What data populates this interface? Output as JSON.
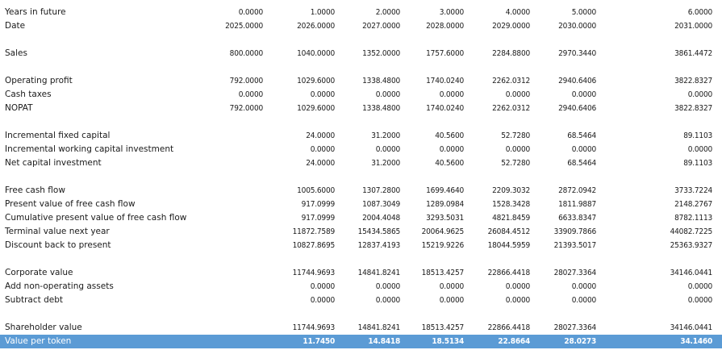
{
  "sheet": {
    "highlight_color": "#5b9bd5",
    "columns": 7,
    "rows": [
      {
        "label": "Years in future",
        "values": [
          "0.0000",
          "1.0000",
          "2.0000",
          "3.0000",
          "4.0000",
          "5.0000",
          "6.0000"
        ]
      },
      {
        "label": "Date",
        "values": [
          "2025.0000",
          "2026.0000",
          "2027.0000",
          "2028.0000",
          "2029.0000",
          "2030.0000",
          "2031.0000"
        ]
      },
      {
        "label": "",
        "values": []
      },
      {
        "label": "Sales",
        "values": [
          "800.0000",
          "1040.0000",
          "1352.0000",
          "1757.6000",
          "2284.8800",
          "2970.3440",
          "3861.4472"
        ]
      },
      {
        "label": "",
        "values": []
      },
      {
        "label": "Operating profit",
        "values": [
          "792.0000",
          "1029.6000",
          "1338.4800",
          "1740.0240",
          "2262.0312",
          "2940.6406",
          "3822.8327"
        ]
      },
      {
        "label": "Cash taxes",
        "values": [
          "0.0000",
          "0.0000",
          "0.0000",
          "0.0000",
          "0.0000",
          "0.0000",
          "0.0000"
        ]
      },
      {
        "label": "NOPAT",
        "values": [
          "792.0000",
          "1029.6000",
          "1338.4800",
          "1740.0240",
          "2262.0312",
          "2940.6406",
          "3822.8327"
        ]
      },
      {
        "label": "",
        "values": []
      },
      {
        "label": "Incremental fixed capital",
        "values": [
          "",
          "24.0000",
          "31.2000",
          "40.5600",
          "52.7280",
          "68.5464",
          "89.1103"
        ]
      },
      {
        "label": "Incremental working capital investment",
        "values": [
          "",
          "0.0000",
          "0.0000",
          "0.0000",
          "0.0000",
          "0.0000",
          "0.0000"
        ]
      },
      {
        "label": "Net capital investment",
        "values": [
          "",
          "24.0000",
          "31.2000",
          "40.5600",
          "52.7280",
          "68.5464",
          "89.1103"
        ]
      },
      {
        "label": "",
        "values": []
      },
      {
        "label": "Free cash flow",
        "values": [
          "",
          "1005.6000",
          "1307.2800",
          "1699.4640",
          "2209.3032",
          "2872.0942",
          "3733.7224"
        ]
      },
      {
        "label": "Present value of free cash flow",
        "values": [
          "",
          "917.0999",
          "1087.3049",
          "1289.0984",
          "1528.3428",
          "1811.9887",
          "2148.2767"
        ]
      },
      {
        "label": "Cumulative present value of free cash flow",
        "values": [
          "",
          "917.0999",
          "2004.4048",
          "3293.5031",
          "4821.8459",
          "6633.8347",
          "8782.1113"
        ]
      },
      {
        "label": "Terminal value next year",
        "values": [
          "",
          "11872.7589",
          "15434.5865",
          "20064.9625",
          "26084.4512",
          "33909.7866",
          "44082.7225"
        ]
      },
      {
        "label": "Discount back to present",
        "values": [
          "",
          "10827.8695",
          "12837.4193",
          "15219.9226",
          "18044.5959",
          "21393.5017",
          "25363.9327"
        ]
      },
      {
        "label": "",
        "values": []
      },
      {
        "label": "Corporate value",
        "values": [
          "",
          "11744.9693",
          "14841.8241",
          "18513.4257",
          "22866.4418",
          "28027.3364",
          "34146.0441"
        ]
      },
      {
        "label": "Add non-operating assets",
        "values": [
          "",
          "0.0000",
          "0.0000",
          "0.0000",
          "0.0000",
          "0.0000",
          "0.0000"
        ]
      },
      {
        "label": "Subtract debt",
        "values": [
          "",
          "0.0000",
          "0.0000",
          "0.0000",
          "0.0000",
          "0.0000",
          "0.0000"
        ]
      },
      {
        "label": "",
        "values": []
      },
      {
        "label": "Shareholder value",
        "values": [
          "",
          "11744.9693",
          "14841.8241",
          "18513.4257",
          "22866.4418",
          "28027.3364",
          "34146.0441"
        ]
      },
      {
        "label": "Value per token",
        "highlight": true,
        "values": [
          "",
          "11.7450",
          "14.8418",
          "18.5134",
          "22.8664",
          "28.0273",
          "34.1460"
        ]
      }
    ]
  }
}
